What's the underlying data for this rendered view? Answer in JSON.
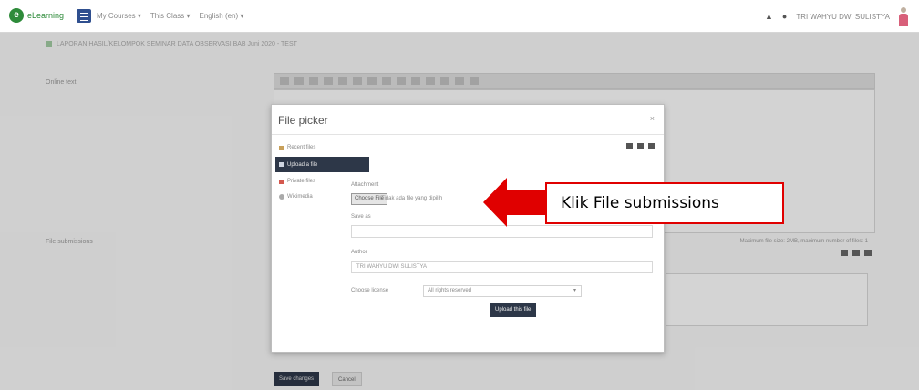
{
  "brand": {
    "name": "eLearning"
  },
  "nav": {
    "menu": [
      "My Courses ▾",
      "This Class ▾",
      "English (en) ▾"
    ],
    "user": "TRI WAHYU DWI SULISTYA"
  },
  "breadcrumb": "LAPORAN HASIL/KELOMPOK SEMINAR DATA OBSERVASI BAB Juni 2020 - TEST",
  "page": {
    "online_text_label": "Online text",
    "file_submissions_label": "File submissions",
    "file_limit_info": "Maximum file size: 2MB, maximum number of files: 1",
    "save_label": "Save changes",
    "cancel_label": "Cancel"
  },
  "modal": {
    "title": "File picker",
    "close": "×",
    "repositories": [
      {
        "label": "Recent files",
        "active": false
      },
      {
        "label": "Upload a file",
        "active": true
      },
      {
        "label": "Private files",
        "active": false
      },
      {
        "label": "Wikimedia",
        "active": false
      }
    ],
    "attachment_label": "Attachment",
    "choose_file": "Choose File",
    "no_file": "Tidak ada file yang dipilih",
    "save_as_label": "Save as",
    "save_as_value": "",
    "author_label": "Author",
    "author_value": "TRI WAHYU DWI SULISTYA",
    "license_label": "Choose license",
    "license_value": "All rights reserved",
    "upload_label": "Upload this file"
  },
  "annotation": {
    "text": "Klik File submissions",
    "color": "#e00000"
  }
}
